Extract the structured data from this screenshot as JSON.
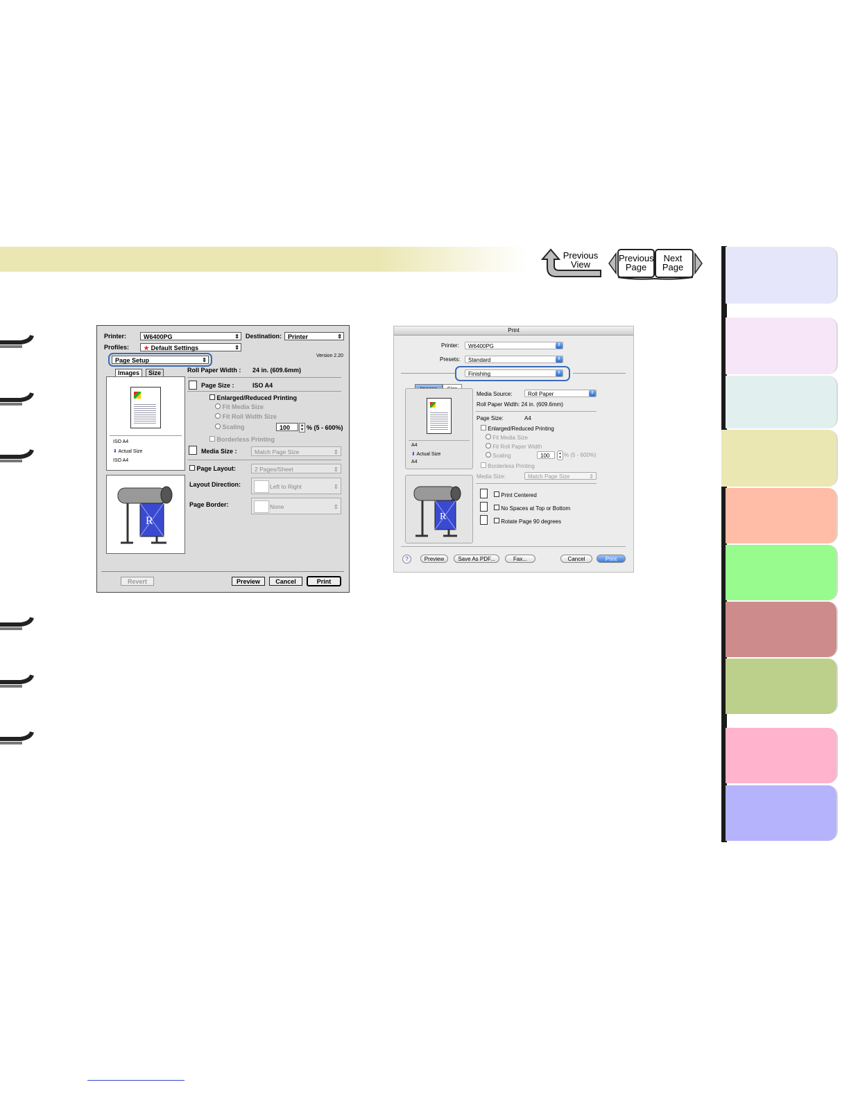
{
  "nav": {
    "previous_view_line1": "Previous",
    "previous_view_line2": "View",
    "previous_page_line1": "Previous",
    "previous_page_line2": "Page",
    "next_page_line1": "Next",
    "next_page_line2": "Page"
  },
  "colors": {
    "band": "#ebe7b3",
    "tabs": [
      "#e6e6fb",
      "#f7e6f7",
      "#e1f0ee",
      "#ebe7b3",
      "#ffbca6",
      "#97fb8e",
      "#ce8b8b",
      "#bccf8b",
      "#ffb3cc",
      "#b5b3fb"
    ],
    "highlight": "#3b6ab6",
    "aqua_blue": "#2d6ad6"
  },
  "os9_dialog": {
    "printer_label": "Printer:",
    "printer_value": "W6400PG",
    "destination_label": "Destination:",
    "destination_value": "Printer",
    "profiles_label": "Profiles:",
    "profiles_value": "Default Settings",
    "version": "Version 2.20",
    "panel_value": "Page Setup",
    "tab_images": "Images",
    "tab_size": "Size",
    "preview_size1": "ISO A4",
    "preview_actual": "Actual Size",
    "preview_size2": "ISO A4",
    "roll_width_label": "Roll Paper Width :",
    "roll_width_value": "24 in. (609.6mm)",
    "page_size_label": "Page Size :",
    "page_size_value": "ISO A4",
    "enlarged_label": "Enlarged/Reduced Printing",
    "fit_media": "Fit Media Size",
    "fit_roll": "Fit Roll Width Size",
    "scaling_label": "Scaling",
    "scaling_value": "100",
    "scaling_range": "% (5 - 600%)",
    "borderless": "Borderless Printing",
    "media_size_label": "Media Size :",
    "media_size_value": "Match Page Size",
    "page_layout_label": "Page Layout:",
    "page_layout_value": "2 Pages/Sheet",
    "layout_dir_label": "Layout Direction:",
    "layout_dir_value": "Left to Right",
    "page_border_label": "Page Border:",
    "page_border_value": "None",
    "revert": "Revert",
    "preview": "Preview",
    "cancel": "Cancel",
    "print": "Print"
  },
  "osx_dialog": {
    "title": "Print",
    "printer_label": "Printer:",
    "printer_value": "W6400PG",
    "presets_label": "Presets:",
    "presets_value": "Standard",
    "panel_value": "Finishing",
    "tab_images": "Images",
    "tab_size": "Size",
    "preview_size1": "A4",
    "preview_actual": "Actual Size",
    "preview_size2": "A4",
    "media_source_label": "Media Source:",
    "media_source_value": "Roll Paper",
    "roll_width": "Roll Paper Width:  24 in. (609.6mm)",
    "page_size_label": "Page Size:",
    "page_size_value": "A4",
    "enlarged": "Enlarged/Reduced Printing",
    "fit_media": "Fit Media Size",
    "fit_roll": "Fit Roll Paper Width",
    "scaling": "Scaling",
    "scaling_value": "100",
    "scaling_range": "% (5 - 600%)",
    "borderless": "Borderless Printing",
    "media_size_label": "Media Size:",
    "media_size_value": "Match Page Size",
    "print_centered": "Print Centered",
    "no_spaces": "No Spaces at Top or Bottom",
    "rotate": "Rotate Page 90 degrees",
    "help": "?",
    "preview": "Preview",
    "save_pdf": "Save As PDF...",
    "fax": "Fax...",
    "cancel": "Cancel",
    "print": "Print"
  }
}
